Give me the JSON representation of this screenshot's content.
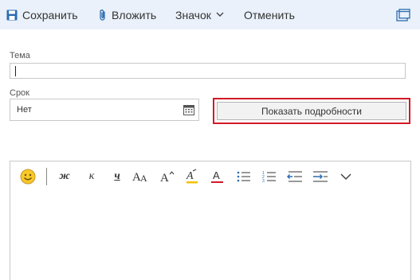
{
  "toolbar": {
    "save_label": "Сохранить",
    "attach_label": "Вложить",
    "icon_label": "Значок",
    "cancel_label": "Отменить",
    "accent_color": "#2b6cb0"
  },
  "form": {
    "subject_label": "Тема",
    "subject_value": "",
    "due_label": "Срок",
    "due_value": "Нет",
    "details_button_label": "Показать подробности",
    "highlight_color": "#d21a26"
  },
  "format_bar": {
    "items": [
      {
        "name": "emoji-icon"
      },
      {
        "name": "bold-icon",
        "glyph": "ж"
      },
      {
        "name": "italic-icon",
        "glyph": "к"
      },
      {
        "name": "underline-icon",
        "glyph": "ч"
      },
      {
        "name": "font-size-icon",
        "glyph": "AA"
      },
      {
        "name": "grow-font-icon",
        "glyph": "A"
      },
      {
        "name": "highlight-icon",
        "glyph": "A"
      },
      {
        "name": "font-color-icon",
        "glyph": "A"
      },
      {
        "name": "bullets-icon"
      },
      {
        "name": "numbering-icon"
      },
      {
        "name": "decrease-indent-icon"
      },
      {
        "name": "increase-indent-icon"
      },
      {
        "name": "more-options-icon"
      }
    ],
    "highlight_swatch": "#f2c200",
    "font_color_swatch": "#d21a26"
  }
}
